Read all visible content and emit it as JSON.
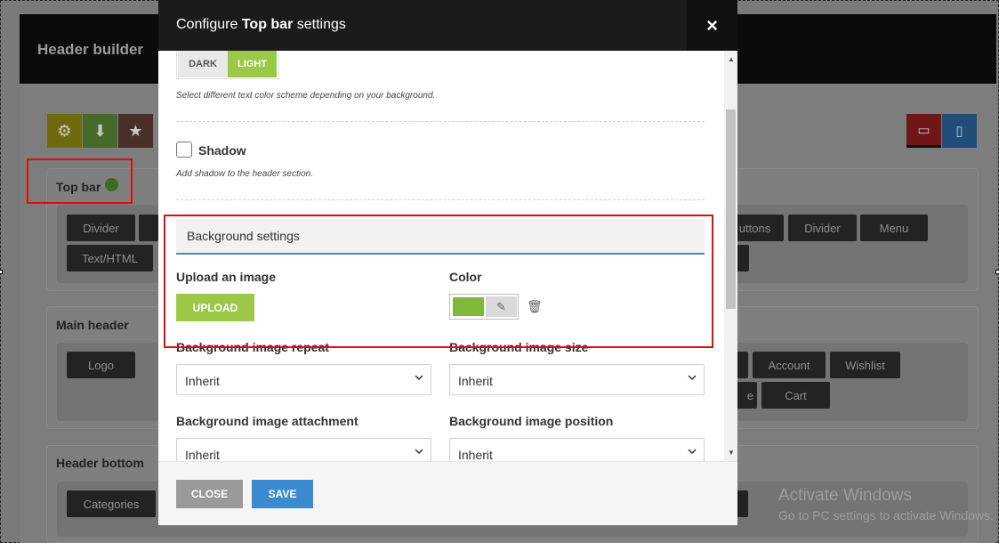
{
  "builder": {
    "title": "Header builder",
    "top_bar": {
      "title": "Top bar",
      "row1": [
        "Divider",
        "uttons",
        "Divider",
        "Menu"
      ],
      "row2": [
        "Text/HTML"
      ]
    },
    "main_header": {
      "title": "Main header",
      "row1": [
        "Logo",
        "Account",
        "Wishlist"
      ],
      "row2": [
        "e",
        "Cart"
      ]
    },
    "header_bottom": {
      "title": "Header bottom",
      "row1": [
        "Categories"
      ]
    },
    "toolbar_icons": [
      "gear-icon",
      "import-icon",
      "star-icon",
      "desktop-icon",
      "mobile-icon"
    ],
    "colors": {
      "gear": "#6f6a10",
      "import": "#456a2a",
      "star": "#4a2e28",
      "desktop": "#6f1616",
      "mobile": "#1f4e7a"
    }
  },
  "modal": {
    "title_prefix": "Configure ",
    "title_bold": "Top bar",
    "title_suffix": " settings",
    "close_icon": "×",
    "color_scheme": {
      "dark_label": "DARK",
      "light_label": "LIGHT",
      "hint": "Select different text color scheme depending on your background."
    },
    "shadow": {
      "label": "Shadow",
      "hint": "Add shadow to the header section.",
      "checked": false
    },
    "background_settings": {
      "heading": "Background settings",
      "upload_label": "Upload an image",
      "upload_button": "UPLOAD",
      "color_label": "Color",
      "color_value": "#82b83a",
      "repeat_label": "Background image repeat",
      "repeat_value": "Inherit",
      "size_label": "Background image size",
      "size_value": "Inherit",
      "attachment_label": "Background image attachment",
      "attachment_value": "Inherit",
      "position_label": "Background image position",
      "position_value": "Inherit"
    },
    "footer": {
      "close_label": "CLOSE",
      "save_label": "SAVE"
    }
  },
  "watermark": {
    "line1": "Activate Windows",
    "line2": "Go to PC settings to activate Windows."
  }
}
